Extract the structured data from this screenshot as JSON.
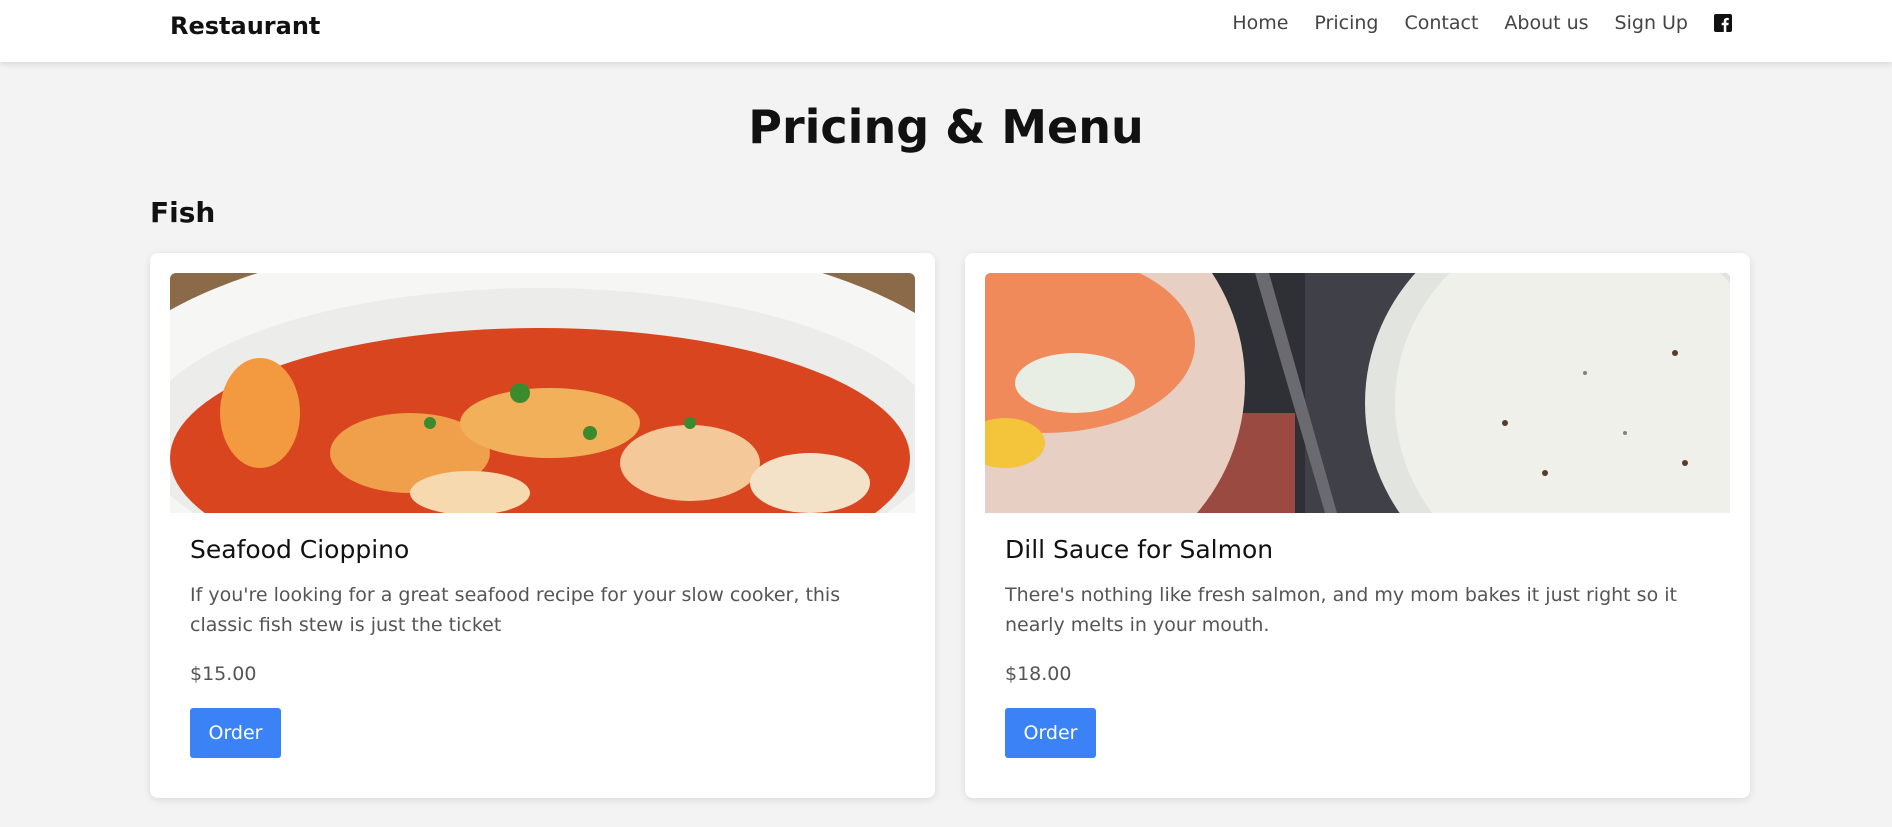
{
  "navbar": {
    "brand": "Restaurant",
    "links": [
      "Home",
      "Pricing",
      "Contact",
      "About us",
      "Sign Up"
    ],
    "social_icon": "facebook-icon"
  },
  "page": {
    "title": "Pricing & Menu"
  },
  "section": {
    "title": "Fish",
    "cards": [
      {
        "title": "Seafood Cioppino",
        "description": "If you're looking for a great seafood recipe for your slow cooker, this classic fish stew is just the ticket",
        "price": "$15.00",
        "button": "Order",
        "image": "seafood-stew-photo"
      },
      {
        "title": "Dill Sauce for Salmon",
        "description": "There's nothing like fresh salmon, and my mom bakes it just right so it nearly melts in your mouth.",
        "price": "$18.00",
        "button": "Order",
        "image": "salmon-dill-sauce-photo"
      }
    ]
  },
  "colors": {
    "accent": "#3b82f6",
    "background": "#f3f3f3",
    "card": "#ffffff"
  }
}
